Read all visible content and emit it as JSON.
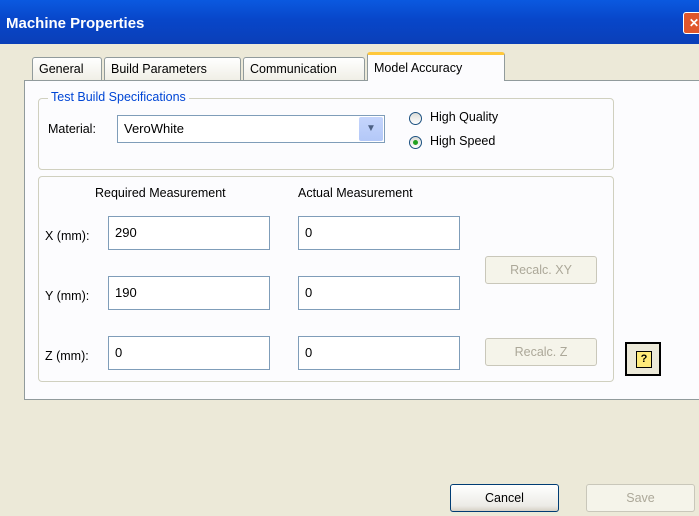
{
  "window": {
    "title": "Machine Properties",
    "close_glyph": "✕"
  },
  "tabs": [
    {
      "label": "General"
    },
    {
      "label": "Build Parameters"
    },
    {
      "label": "Communication"
    },
    {
      "label": "Model Accuracy"
    }
  ],
  "active_tab": "Model Accuracy",
  "specs": {
    "legend": "Test Build Specifications",
    "material_label": "Material:",
    "material_value": "VeroWhite",
    "radio_high_quality": "High Quality",
    "radio_high_speed": "High Speed",
    "selected_mode": "High Speed"
  },
  "measurements": {
    "required_header": "Required Measurement",
    "actual_header": "Actual Measurement",
    "x_label": "X (mm):",
    "y_label": "Y (mm):",
    "z_label": "Z (mm):",
    "x_required": "290",
    "y_required": "190",
    "z_required": "0",
    "x_actual": "0",
    "y_actual": "0",
    "z_actual": "0",
    "recalc_xy": "Recalc. XY",
    "recalc_z": "Recalc. Z"
  },
  "footer": {
    "cancel": "Cancel",
    "save": "Save"
  },
  "icons": {
    "help": "help-icon",
    "dropdown": "chevron-down-icon",
    "close": "close-icon"
  },
  "colors": {
    "title_bar": "#0846c9",
    "legend_text": "#0046d5",
    "active_tab_accent": "#ffc83c",
    "radio_selected": "#21a121"
  }
}
